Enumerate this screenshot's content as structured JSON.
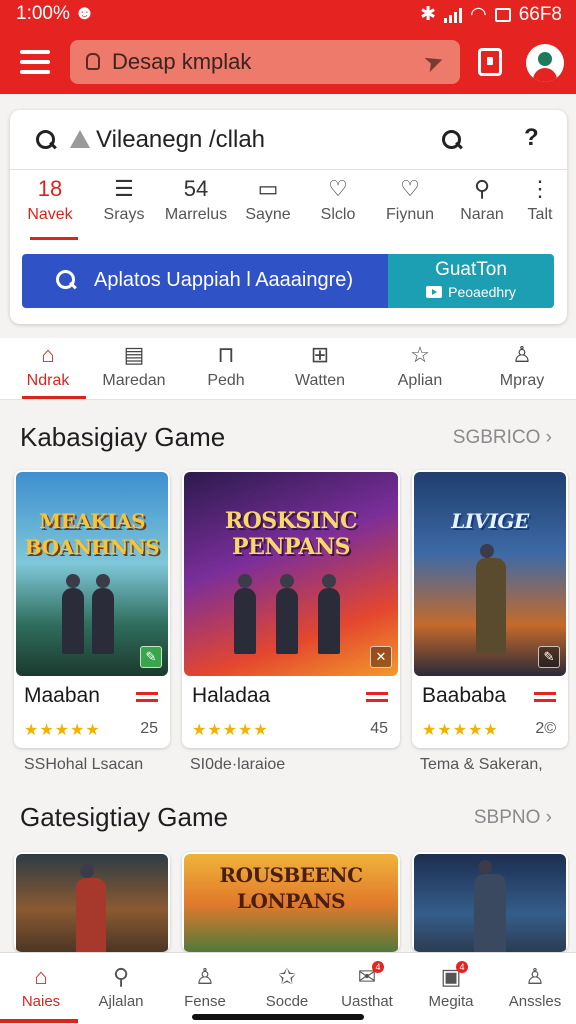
{
  "status_bar": {
    "time": "1:00%",
    "right_text": "66F8"
  },
  "app_bar": {
    "url_text": "Desap kmplak"
  },
  "search": {
    "query": "Vileanegn /cllah"
  },
  "shortcuts": [
    {
      "top": "18",
      "label": "Navek"
    },
    {
      "top": "",
      "label": "Srays",
      "icon": "list-icon"
    },
    {
      "top": "54",
      "label": "Marrelus"
    },
    {
      "top": "",
      "label": "Sayne",
      "icon": "chat-icon"
    },
    {
      "top": "",
      "label": "Slclo",
      "icon": "heart-icon"
    },
    {
      "top": "",
      "label": "Fiynun",
      "icon": "heart-icon"
    },
    {
      "top": "",
      "label": "Naran",
      "icon": "pin-icon"
    },
    {
      "top": "",
      "label": "Talt",
      "icon": "more-icon"
    }
  ],
  "promo": {
    "text": "Aplatos Uappiah l Aaaaingre)",
    "button_title": "GuatTon",
    "button_sub": "Peoaedhry"
  },
  "categories": [
    {
      "label": "Ndrak",
      "icon": "home-icon"
    },
    {
      "label": "Maredan",
      "icon": "document-icon"
    },
    {
      "label": "Pedh",
      "icon": "bookmark-icon"
    },
    {
      "label": "Watten",
      "icon": "grid-icon"
    },
    {
      "label": "Aplian",
      "icon": "star-icon"
    },
    {
      "label": "Mpray",
      "icon": "person-icon"
    }
  ],
  "section1": {
    "title": "Kabasigiay Game",
    "see_all": "SGBRICO",
    "cards": [
      {
        "art_title": "MEAKIAS BOANHNNS",
        "name": "Maaban",
        "stars": "★★★★★",
        "count": "25",
        "subtitle": "SSHohal Lsacan"
      },
      {
        "art_title": "ROSKSINC PENPANS",
        "name": "Haladaa",
        "stars": "★★★★★",
        "count": "45",
        "subtitle": "SI0de·laraioe"
      },
      {
        "art_title": "LIVIGE",
        "name": "Baababa",
        "stars": "★★★★★",
        "count": "2©",
        "subtitle": "Tema & Sakeran,"
      }
    ]
  },
  "section2": {
    "title": "Gatesigtiay Game",
    "see_all": "SBPNO",
    "cards": [
      {
        "art_title": ""
      },
      {
        "art_title": "ROUSBEENC LONPANS"
      },
      {
        "art_title": ""
      }
    ]
  },
  "bottom_nav": [
    {
      "label": "Naies",
      "icon": "home-icon"
    },
    {
      "label": "Ajlalan",
      "icon": "search-icon"
    },
    {
      "label": "Fense",
      "icon": "person-icon"
    },
    {
      "label": "Socde",
      "icon": "star-icon"
    },
    {
      "label": "Uasthat",
      "icon": "mail-icon",
      "badge": "4"
    },
    {
      "label": "Megita",
      "icon": "box-icon",
      "badge": "4"
    },
    {
      "label": "Anssles",
      "icon": "person-icon"
    }
  ],
  "colors": {
    "brand_red": "#e52320",
    "promo_blue": "#2f52c6",
    "promo_teal": "#1c9fb3",
    "star_gold": "#f2b300"
  }
}
